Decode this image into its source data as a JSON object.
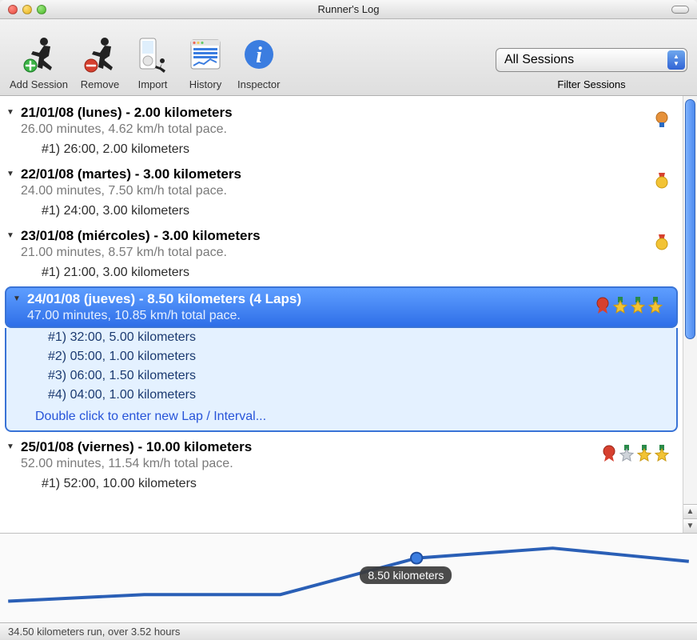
{
  "window_title": "Runner's Log",
  "toolbar": {
    "add": "Add Session",
    "remove": "Remove",
    "import": "Import",
    "history": "History",
    "inspector": "Inspector"
  },
  "filter": {
    "selected": "All Sessions",
    "label": "Filter Sessions"
  },
  "sessions": [
    {
      "title": "21/01/08 (lunes) - 2.00 kilometers",
      "subtitle": "26.00 minutes, 4.62 km/h total pace.",
      "medals": [
        "bronze"
      ],
      "selected": false,
      "laps": [
        "#1) 26:00, 2.00 kilometers"
      ]
    },
    {
      "title": "22/01/08 (martes) - 3.00 kilometers",
      "subtitle": "24.00 minutes, 7.50 km/h total pace.",
      "medals": [
        "gold-ribbon"
      ],
      "selected": false,
      "laps": [
        "#1) 24:00, 3.00 kilometers"
      ]
    },
    {
      "title": "23/01/08 (miércoles) - 3.00 kilometers",
      "subtitle": "21.00 minutes, 8.57 km/h total pace.",
      "medals": [
        "gold-ribbon"
      ],
      "selected": false,
      "laps": [
        "#1) 21:00, 3.00 kilometers"
      ]
    },
    {
      "title": "24/01/08 (jueves) - 8.50 kilometers (4 Laps)",
      "subtitle": "47.00 minutes, 10.85 km/h total pace.",
      "medals": [
        "red-ribbon",
        "star-gold",
        "star-gold",
        "star-gold"
      ],
      "selected": true,
      "laps": [
        "#1) 32:00, 5.00 kilometers",
        "#2) 05:00, 1.00 kilometers",
        "#3) 06:00, 1.50 kilometers",
        "#4) 04:00, 1.00 kilometers"
      ],
      "new_lap_hint": "Double click to enter new Lap / Interval..."
    },
    {
      "title": "25/01/08 (viernes) - 10.00 kilometers",
      "subtitle": "52.00 minutes, 11.54 km/h total pace.",
      "medals": [
        "red-ribbon",
        "star-silver",
        "star-gold",
        "star-gold"
      ],
      "selected": false,
      "laps": [
        "#1) 52:00, 10.00 kilometers"
      ]
    }
  ],
  "chart_data": {
    "type": "line",
    "x": [
      0,
      1,
      2,
      3,
      4,
      5
    ],
    "values": [
      2.0,
      3.0,
      3.0,
      8.5,
      10.0,
      8.0
    ],
    "highlighted_index": 3,
    "tooltip": "8.50 kilometers",
    "ylim": [
      0,
      11
    ]
  },
  "status": "34.50 kilometers run, over 3.52 hours"
}
